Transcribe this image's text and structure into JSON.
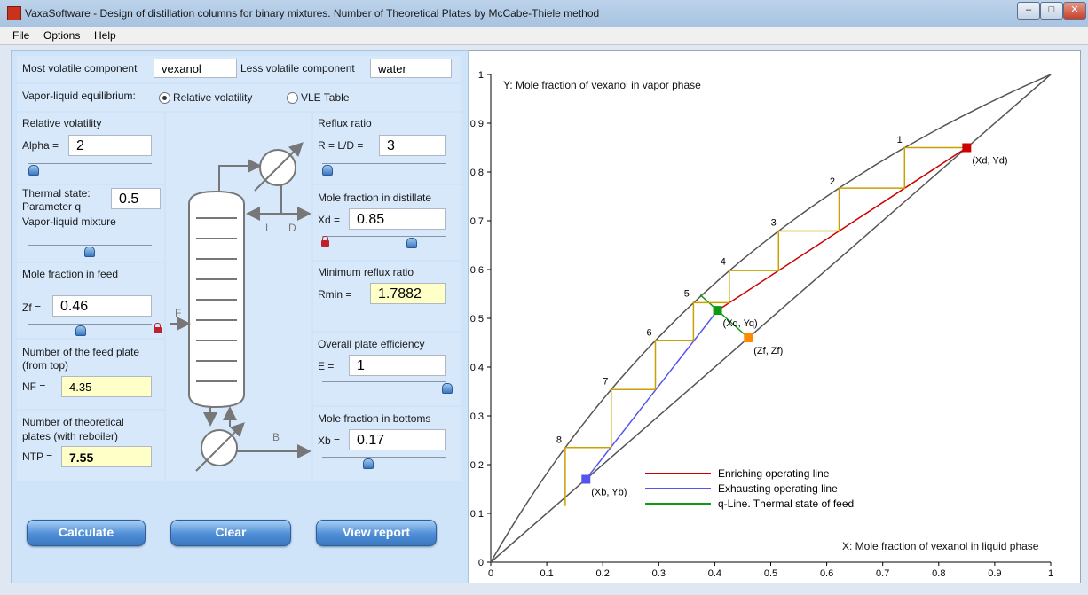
{
  "window": {
    "title": "VaxaSoftware - Design of distillation columns for binary mixtures. Number of Theoretical Plates by McCabe-Thiele method",
    "controls": {
      "minimize": "–",
      "maximize": "□",
      "close": "✕"
    }
  },
  "menu": [
    "File",
    "Options",
    "Help"
  ],
  "components": {
    "most_volatile_label": "Most volatile component",
    "most_volatile_value": "vexanol",
    "less_volatile_label": "Less volatile component",
    "less_volatile_value": "water"
  },
  "vle": {
    "label": "Vapor-liquid equilibrium:",
    "option_relative": "Relative volatility",
    "option_table": "VLE Table",
    "selected": "Relative volatility"
  },
  "relative_volatility": {
    "title": "Relative volatility",
    "alpha_label": "Alpha =",
    "alpha_value": "2",
    "slider_level": 0.08
  },
  "thermal_state": {
    "title": "Thermal state:",
    "param_label": "Parameter q",
    "q_value": "0.5",
    "state_text": "Vapor-liquid mixture",
    "slider_level": 0.5
  },
  "feed_fraction": {
    "title": "Mole fraction in feed",
    "zf_label": "Zf =",
    "zf_value": "0.46",
    "slider_level": 0.46
  },
  "feed_plate": {
    "title_line1": "Number of the feed plate",
    "title_line2": "(from top)",
    "nf_label": "NF =",
    "nf_value": "4.35"
  },
  "theoretical_plates": {
    "title_line1": "Number of theoretical",
    "title_line2": "plates (with reboiler)",
    "ntp_label": "NTP =",
    "ntp_value": "7.55"
  },
  "reflux": {
    "title": "Reflux ratio",
    "r_label": "R = L/D =",
    "r_value": "3",
    "slider_level": 0.03
  },
  "distillate": {
    "title": "Mole fraction in distillate",
    "xd_label": "Xd =",
    "xd_value": "0.85",
    "slider_level": 0.72
  },
  "min_reflux": {
    "title": "Minimum reflux ratio",
    "rmin_label": "Rmin =",
    "rmin_value": "1.7882"
  },
  "efficiency": {
    "title": "Overall plate efficiency",
    "e_label": "E =",
    "e_value": "1",
    "slider_level": 1.0
  },
  "bottoms": {
    "title": "Mole fraction in bottoms",
    "xb_label": "Xb =",
    "xb_value": "0.17",
    "slider_level": 0.34
  },
  "column_diagram": {
    "F": "F",
    "L": "L",
    "D": "D",
    "B": "B"
  },
  "buttons": {
    "calculate": "Calculate",
    "clear": "Clear",
    "view_report": "View report"
  },
  "chart_data": {
    "type": "line",
    "title": "",
    "xlabel": "X: Mole fraction of vexanol in liquid phase",
    "ylabel": "Y: Mole fraction of vexanol in vapor phase",
    "xlim": [
      0,
      1
    ],
    "ylim": [
      0,
      1
    ],
    "xticks": [
      "0",
      "0.1",
      "0.2",
      "0.3",
      "0.4",
      "0.5",
      "0.6",
      "0.7",
      "0.8",
      "0.9",
      "1"
    ],
    "yticks": [
      "0",
      "0.1",
      "0.2",
      "0.3",
      "0.4",
      "0.5",
      "0.6",
      "0.7",
      "0.8",
      "0.9",
      "1"
    ],
    "alpha": 2,
    "legend": {
      "placement": "bottom-center",
      "entries": [
        {
          "label": "Enriching operating line",
          "color": "#cc0000"
        },
        {
          "label": "Exhausting operating line",
          "color": "#5555ee"
        },
        {
          "label": "q-Line. Thermal state of feed",
          "color": "#119911"
        }
      ]
    },
    "enriching_line": [
      [
        0.405,
        0.5162
      ],
      [
        0.85,
        0.85
      ]
    ],
    "exhausting_line": [
      [
        0.17,
        0.17
      ],
      [
        0.405,
        0.5162
      ]
    ],
    "q_line": [
      [
        0.374,
        0.548
      ],
      [
        0.46,
        0.46
      ]
    ],
    "steps": [
      [
        0.85,
        0.85
      ],
      [
        0.739,
        0.85
      ],
      [
        0.739,
        0.767
      ],
      [
        0.622,
        0.767
      ],
      [
        0.622,
        0.679
      ],
      [
        0.514,
        0.679
      ],
      [
        0.514,
        0.598
      ],
      [
        0.426,
        0.598
      ],
      [
        0.426,
        0.532
      ],
      [
        0.362,
        0.532
      ],
      [
        0.362,
        0.455
      ],
      [
        0.294,
        0.455
      ],
      [
        0.294,
        0.354
      ],
      [
        0.215,
        0.354
      ],
      [
        0.215,
        0.235
      ],
      [
        0.133,
        0.235
      ],
      [
        0.133,
        0.115
      ]
    ],
    "plate_labels": [
      {
        "text": "1",
        "x": 0.73,
        "y": 0.86
      },
      {
        "text": "2",
        "x": 0.61,
        "y": 0.775
      },
      {
        "text": "3",
        "x": 0.505,
        "y": 0.69
      },
      {
        "text": "4",
        "x": 0.415,
        "y": 0.61
      },
      {
        "text": "5",
        "x": 0.35,
        "y": 0.545
      },
      {
        "text": "6",
        "x": 0.283,
        "y": 0.465
      },
      {
        "text": "7",
        "x": 0.205,
        "y": 0.365
      },
      {
        "text": "8",
        "x": 0.122,
        "y": 0.245
      }
    ],
    "points": [
      {
        "label": "(Xd, Yd)",
        "x": 0.85,
        "y": 0.85,
        "color": "#cc0000"
      },
      {
        "label": "(Xq, Yq)",
        "x": 0.405,
        "y": 0.5162,
        "color": "#119911"
      },
      {
        "label": "(Zf, Zf)",
        "x": 0.46,
        "y": 0.46,
        "color": "#ff8c00"
      },
      {
        "label": "(Xb, Yb)",
        "x": 0.17,
        "y": 0.17,
        "color": "#5555ee"
      }
    ],
    "colors": {
      "equilibrium": "#555555",
      "diagonal": "#555555",
      "steps": "#c8a000"
    }
  }
}
